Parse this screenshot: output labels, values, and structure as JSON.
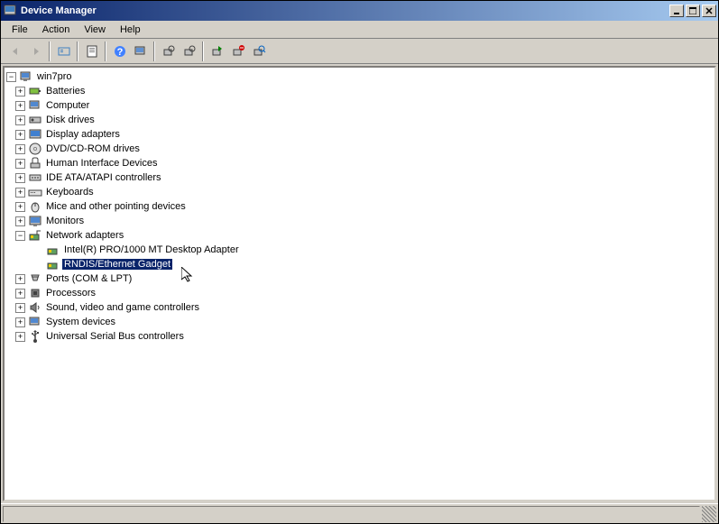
{
  "window": {
    "title": "Device Manager"
  },
  "menu": {
    "file": "File",
    "action": "Action",
    "view": "View",
    "help": "Help"
  },
  "tree": {
    "root": "win7pro",
    "nodes": {
      "batteries": "Batteries",
      "computer": "Computer",
      "disk": "Disk drives",
      "display": "Display adapters",
      "dvd": "DVD/CD-ROM drives",
      "hid": "Human Interface Devices",
      "ide": "IDE ATA/ATAPI controllers",
      "keyboards": "Keyboards",
      "mice": "Mice and other pointing devices",
      "monitors": "Monitors",
      "network": "Network adapters",
      "ports": "Ports (COM & LPT)",
      "processors": "Processors",
      "sound": "Sound, video and game controllers",
      "system": "System devices",
      "usb": "Universal Serial Bus controllers"
    },
    "network_children": {
      "intel": "Intel(R) PRO/1000 MT Desktop Adapter",
      "rndis": "RNDIS/Ethernet Gadget"
    }
  }
}
